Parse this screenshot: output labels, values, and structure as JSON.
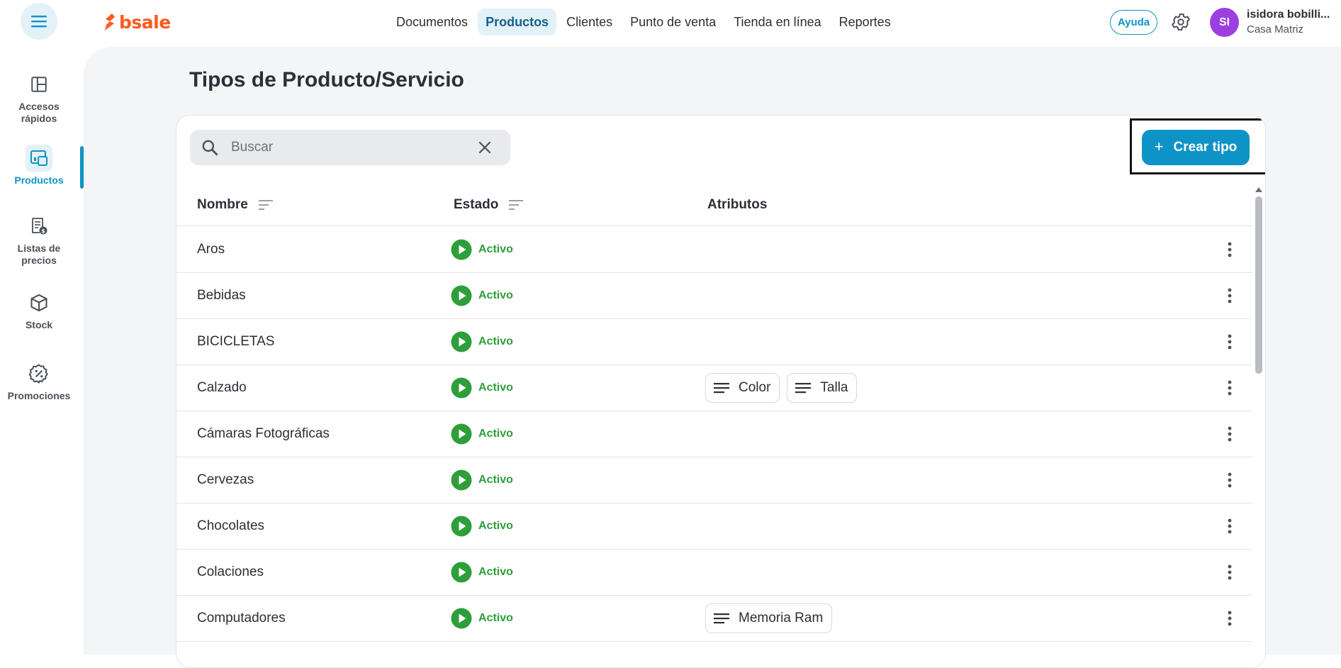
{
  "app": {
    "brand": "bsale"
  },
  "topnav": {
    "items": [
      {
        "label": "Documentos",
        "active": false
      },
      {
        "label": "Productos",
        "active": true
      },
      {
        "label": "Clientes",
        "active": false
      },
      {
        "label": "Punto de venta",
        "active": false
      },
      {
        "label": "Tienda en línea",
        "active": false
      },
      {
        "label": "Reportes",
        "active": false
      }
    ],
    "help_label": "Ayuda",
    "user": {
      "initials": "SI",
      "name": "isidora bobilli...",
      "branch": "Casa Matriz"
    }
  },
  "sidebar": {
    "items": [
      {
        "label": "Accesos rápidos",
        "icon": "quick-access-icon",
        "active": false
      },
      {
        "label": "Productos",
        "icon": "products-icon",
        "active": true
      },
      {
        "label": "Listas de precios",
        "icon": "price-list-icon",
        "active": false
      },
      {
        "label": "Stock",
        "icon": "stock-box-icon",
        "active": false
      },
      {
        "label": "Promociones",
        "icon": "promotions-icon",
        "active": false
      }
    ]
  },
  "page": {
    "title": "Tipos de Producto/Servicio",
    "search": {
      "placeholder": "Buscar",
      "value": ""
    },
    "create_button": {
      "plus": "+",
      "label": "Crear tipo"
    },
    "table": {
      "columns": {
        "name": "Nombre",
        "status": "Estado",
        "attributes": "Atributos"
      },
      "rows": [
        {
          "name": "Aros",
          "status": "Activo",
          "attributes": []
        },
        {
          "name": "Bebidas",
          "status": "Activo",
          "attributes": []
        },
        {
          "name": "BICICLETAS",
          "status": "Activo",
          "attributes": []
        },
        {
          "name": "Calzado",
          "status": "Activo",
          "attributes": [
            "Color",
            "Talla"
          ]
        },
        {
          "name": "Cámaras Fotográficas",
          "status": "Activo",
          "attributes": []
        },
        {
          "name": "Cervezas",
          "status": "Activo",
          "attributes": []
        },
        {
          "name": "Chocolates",
          "status": "Activo",
          "attributes": []
        },
        {
          "name": "Colaciones",
          "status": "Activo",
          "attributes": []
        },
        {
          "name": "Computadores",
          "status": "Activo",
          "attributes": [
            "Memoria Ram"
          ]
        }
      ]
    }
  },
  "colors": {
    "accent": "#0e93c6",
    "brand_orange": "#ff5a1f",
    "status_active": "#2e9e3a",
    "avatar": "#9c3fe0"
  }
}
